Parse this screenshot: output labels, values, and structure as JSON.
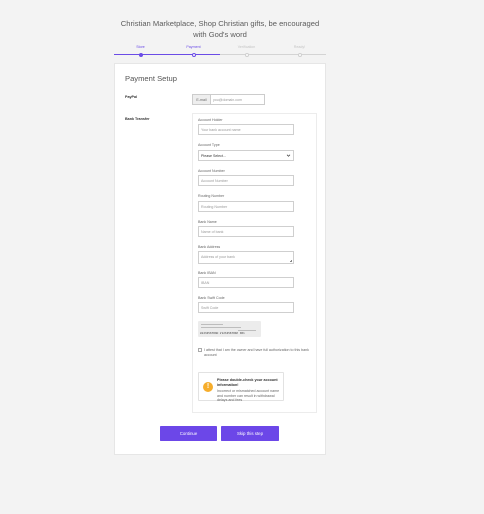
{
  "page": {
    "title": "Christian Marketplace, Shop Christian gifts, be encouraged with God's word"
  },
  "steps": [
    {
      "label": "Store",
      "state": "done"
    },
    {
      "label": "Payment",
      "state": "active"
    },
    {
      "label": "Verification",
      "state": "pending"
    },
    {
      "label": "Ready!",
      "state": "pending"
    }
  ],
  "colors": {
    "accent": "#6c47e8",
    "warning": "#f6ad2b"
  },
  "card": {
    "title": "Payment Setup",
    "paypal": {
      "label": "PayPal",
      "addon": "E-mail",
      "placeholder": "you@domain.com"
    },
    "bank": {
      "label": "Bank Transfer",
      "fields": {
        "holder": {
          "label": "Account Holder",
          "placeholder": "Your bank account name"
        },
        "type": {
          "label": "Account Type",
          "value": "Please Select..."
        },
        "number": {
          "label": "Account Number",
          "placeholder": "Account Number"
        },
        "routing": {
          "label": "Routing Number",
          "placeholder": "Routing Number"
        },
        "bank_name": {
          "label": "Bank Name",
          "placeholder": "Name of bank"
        },
        "address": {
          "label": "Bank Address",
          "placeholder": "Address of your bank"
        },
        "iban": {
          "label": "Bank IBAN",
          "placeholder": "IBAN"
        },
        "swift": {
          "label": "Bank Swift Code",
          "placeholder": "Swift Code"
        }
      },
      "cheque_micr": "⑆123456789⑆ ⑈123456789⑈ 001",
      "attest": "I attest that I am the owner and have full authorization to this bank account",
      "alert": {
        "icon": "warning-icon",
        "symbol": "!",
        "title": "Please double-check your account information!",
        "text": "Incorrect or mismatched account name and number can result in withdrawal delays and fees"
      }
    }
  },
  "buttons": {
    "continue": "Continue",
    "skip": "Skip this step"
  }
}
